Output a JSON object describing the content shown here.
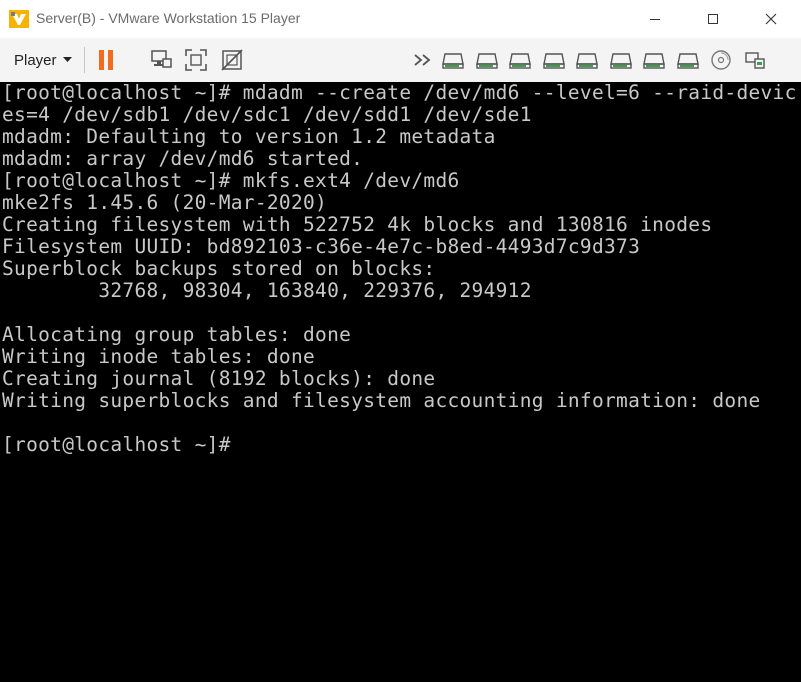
{
  "window": {
    "title": "Server(B) - VMware Workstation 15 Player",
    "controls": [
      "minimize",
      "maximize",
      "close"
    ]
  },
  "toolbar": {
    "player_menu_label": "Player",
    "left_icons": [
      "pause-icon",
      "send-ctrl-alt-del-icon",
      "fullscreen-icon",
      "unity-icon"
    ],
    "overflow_icon": "double-chevron-right-icon",
    "device_icons": [
      "hard-disk-icon",
      "hard-disk-icon",
      "hard-disk-icon",
      "hard-disk-icon",
      "hard-disk-icon",
      "hard-disk-icon",
      "hard-disk-icon",
      "hard-disk-icon",
      "cd-dvd-icon",
      "network-adapter-icon"
    ]
  },
  "terminal": {
    "lines": [
      "[root@localhost ~]# mdadm --create /dev/md6 --level=6 --raid-devic",
      "es=4 /dev/sdb1 /dev/sdc1 /dev/sdd1 /dev/sde1",
      "mdadm: Defaulting to version 1.2 metadata",
      "mdadm: array /dev/md6 started.",
      "[root@localhost ~]# mkfs.ext4 /dev/md6",
      "mke2fs 1.45.6 (20-Mar-2020)",
      "Creating filesystem with 522752 4k blocks and 130816 inodes",
      "Filesystem UUID: bd892103-c36e-4e7c-b8ed-4493d7c9d373",
      "Superblock backups stored on blocks:",
      "        32768, 98304, 163840, 229376, 294912",
      "",
      "Allocating group tables: done",
      "Writing inode tables: done",
      "Creating journal (8192 blocks): done",
      "Writing superblocks and filesystem accounting information: done",
      "",
      "[root@localhost ~]#"
    ]
  },
  "colors": {
    "terminal_bg": "#000000",
    "terminal_fg": "#c8c8c8",
    "pause_orange": "#f26b21",
    "toolbar_bg": "#f4f4f4",
    "device_icon_green": "#3aa14a"
  }
}
